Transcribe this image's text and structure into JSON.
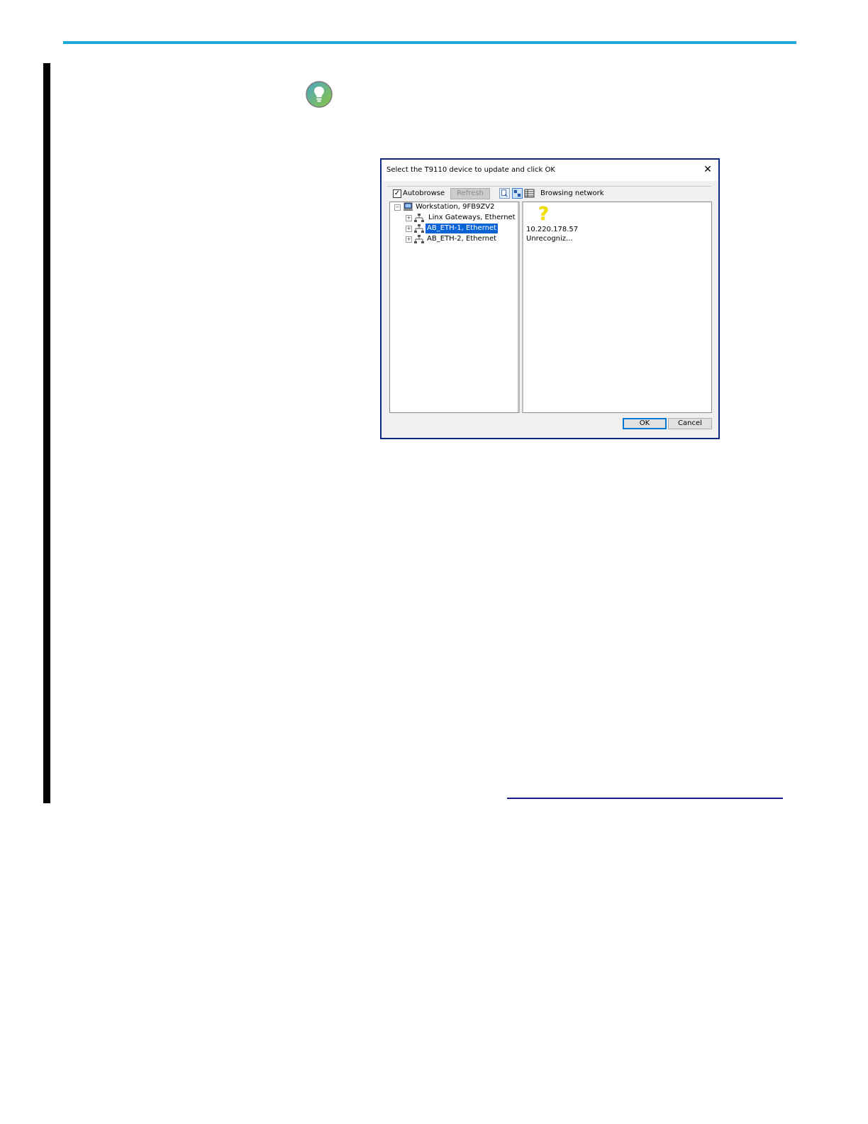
{
  "colors": {
    "accent_rule": "#1ba9dc",
    "selection": "#0a64d8",
    "dialog_border": "#0a2a80"
  },
  "page": {
    "tip_icon": "lightbulb-icon"
  },
  "dialog": {
    "title": "Select the T9110 device to update and click OK",
    "close_label": "✕",
    "toolbar": {
      "autobrowse_checked": true,
      "autobrowse_label": "Autobrowse",
      "refresh_label": "Refresh",
      "icons": [
        "browse-tree-icon",
        "device-view-icon",
        "list-view-icon"
      ],
      "status": "Browsing network"
    },
    "tree": [
      {
        "label": "Workstation, 9FB9ZV2",
        "icon": "computer-icon",
        "expander": "−",
        "selected": false
      },
      {
        "label": "Linx Gateways, Ethernet",
        "icon": "network-icon",
        "expander": "+",
        "selected": false
      },
      {
        "label": "AB_ETH-1, Ethernet",
        "icon": "network-icon",
        "expander": "+",
        "selected": true
      },
      {
        "label": "AB_ETH-2, Ethernet",
        "icon": "network-icon",
        "expander": "+",
        "selected": false
      }
    ],
    "device": {
      "icon": "question-mark-icon",
      "glyph": "?",
      "ip": "10.220.178.57",
      "status": "Unrecogniz..."
    },
    "buttons": {
      "ok": "OK",
      "cancel": "Cancel"
    }
  }
}
